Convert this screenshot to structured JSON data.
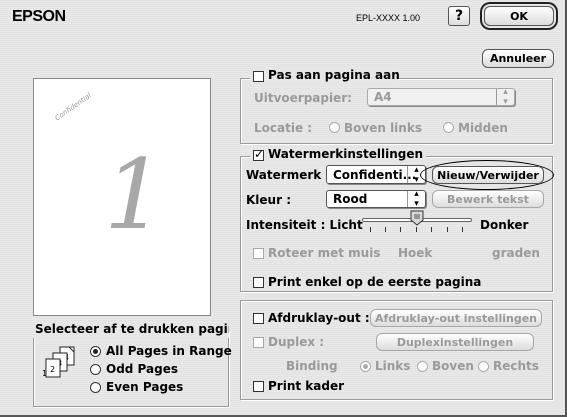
{
  "header": {
    "brand": "EPSON",
    "model": "EPL-XXXX  1.00",
    "help": "?",
    "ok": "OK",
    "cancel": "Annuleer"
  },
  "preview": {
    "page_number": "1",
    "watermark_text": "Confidential"
  },
  "fit_page": {
    "label": "Pas aan pagina aan",
    "checked": false,
    "output_paper_label": "Uitvoerpapier:",
    "output_paper_value": "A4",
    "location_label": "Locatie :",
    "location_options": [
      "Boven links",
      "Midden"
    ]
  },
  "watermark": {
    "group_label": "Watermerkinstellingen",
    "checked": true,
    "watermark_label": "Watermerk :",
    "watermark_value": "Confidenti...",
    "new_delete_button": "Nieuw/Verwijder",
    "color_label": "Kleur :",
    "color_value": "Rood",
    "edit_text_button": "Bewerk tekst",
    "intensity_label": "Intensiteit : Licht",
    "intensity_dark": "Donker",
    "intensity_level": 0.5,
    "rotate_label": "Roteer met muis",
    "angle_label": "Hoek",
    "degrees_label": "graden",
    "first_page_label": "Print enkel op de eerste pagina"
  },
  "page_select": {
    "title": "Selecteer af te drukken pagina",
    "options": [
      "All Pages in Range",
      "Odd Pages",
      "Even Pages"
    ],
    "selected": "All Pages in Range"
  },
  "layout": {
    "print_layout_label": "Afdruklay-out :",
    "print_layout_button": "Afdruklay-out instellingen",
    "duplex_label": "Duplex :",
    "duplex_button": "Duplexinstellingen",
    "binding_label": "Binding",
    "binding_options": [
      "Links",
      "Boven",
      "Rechts"
    ],
    "binding_selected": "Links",
    "print_frame_label": "Print kader"
  }
}
